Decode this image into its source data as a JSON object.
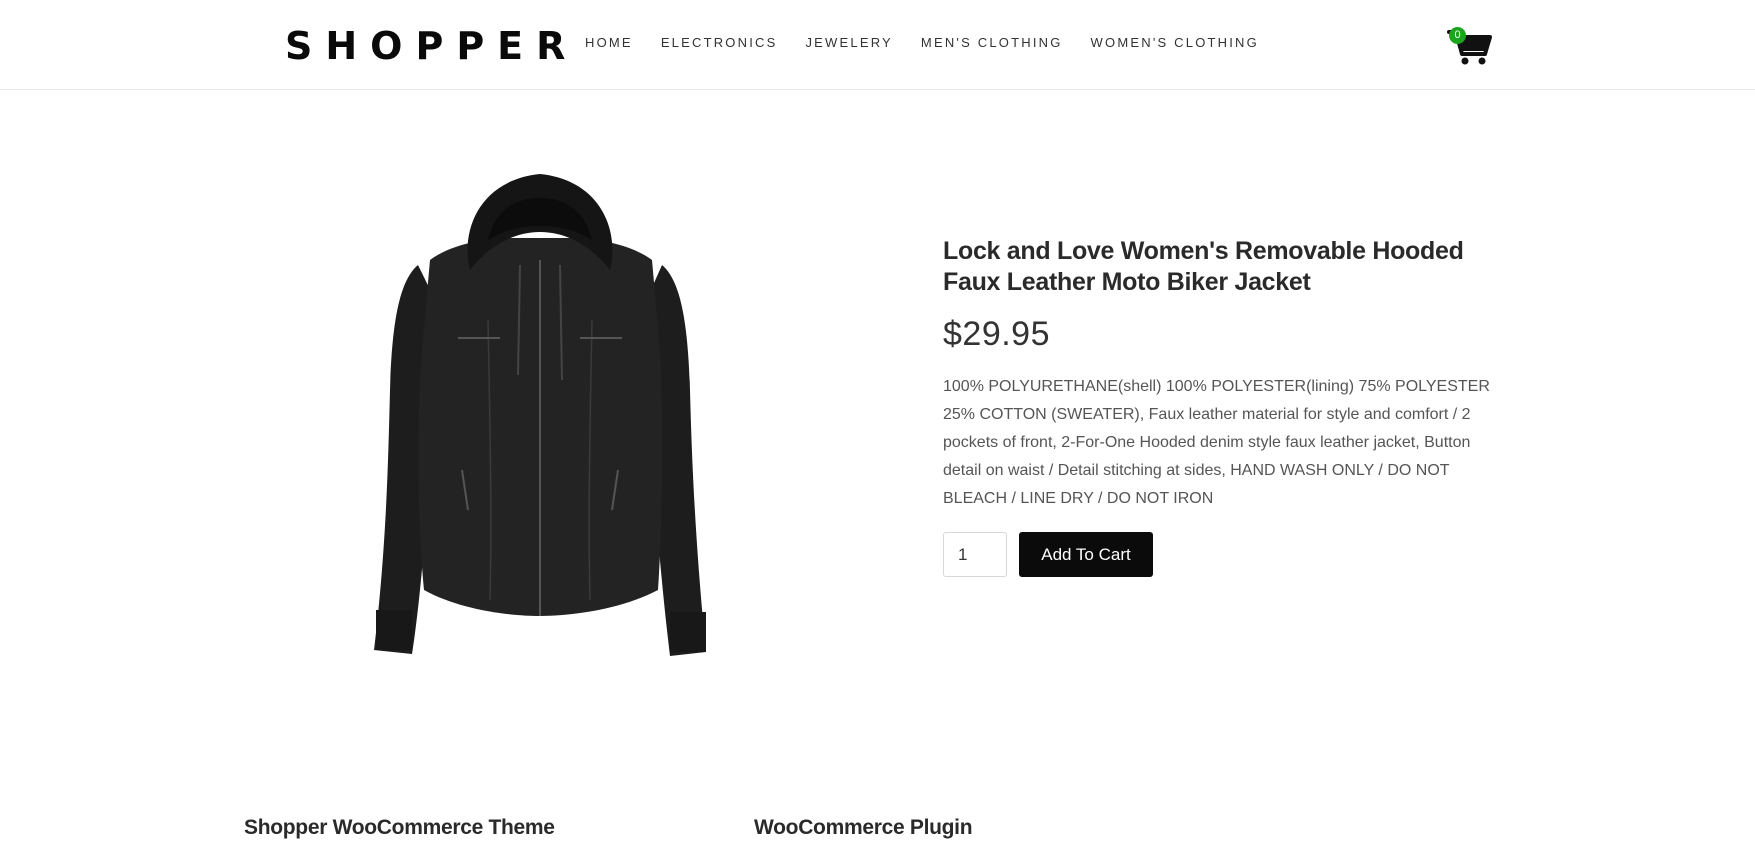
{
  "brand": {
    "logo": "SHOPPER"
  },
  "nav": {
    "items": [
      {
        "label": "HOME"
      },
      {
        "label": "ELECTRONICS"
      },
      {
        "label": "JEWELERY"
      },
      {
        "label": "MEN'S CLOTHING"
      },
      {
        "label": "WOMEN'S CLOTHING"
      }
    ]
  },
  "cart": {
    "count": "0",
    "icon": "shopping-cart-icon",
    "badge_color": "#1aa51a"
  },
  "product": {
    "image_icon": "jacket-image",
    "title": "Lock and Love Women's Removable Hooded Faux Leather Moto Biker Jacket",
    "price": "$29.95",
    "description": "100% POLYURETHANE(shell) 100% POLYESTER(lining) 75% POLYESTER 25% COTTON (SWEATER), Faux leather material for style and comfort / 2 pockets of front, 2-For-One Hooded denim style faux leather jacket, Button detail on waist / Detail stitching at sides, HAND WASH ONLY / DO NOT BLEACH / LINE DRY / DO NOT IRON",
    "quantity": "1",
    "add_to_cart_label": "Add To Cart"
  },
  "footer": {
    "col1_title": "Shopper WooCommerce Theme",
    "col2_title": "WooCommerce Plugin"
  }
}
